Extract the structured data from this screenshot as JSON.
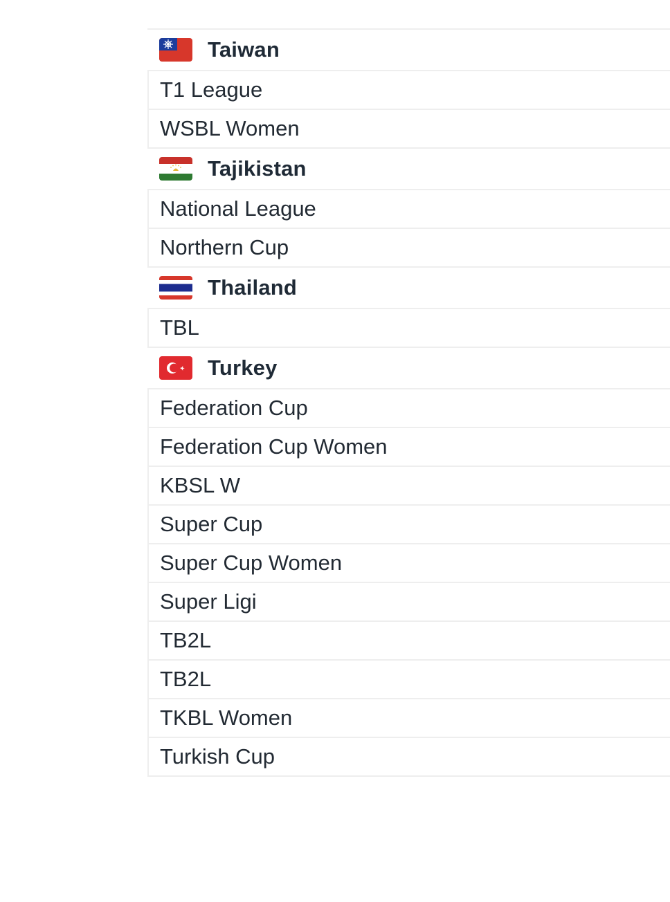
{
  "groups": [
    {
      "country": "Taiwan",
      "flag_icon": "taiwan-flag-icon",
      "leagues": [
        "T1 League",
        "WSBL Women"
      ]
    },
    {
      "country": "Tajikistan",
      "flag_icon": "tajikistan-flag-icon",
      "leagues": [
        "National League",
        "Northern Cup"
      ]
    },
    {
      "country": "Thailand",
      "flag_icon": "thailand-flag-icon",
      "leagues": [
        "TBL"
      ]
    },
    {
      "country": "Turkey",
      "flag_icon": "turkey-flag-icon",
      "leagues": [
        "Federation Cup",
        "Federation Cup Women",
        "KBSL W",
        "Super Cup",
        "Super Cup Women",
        "Super Ligi",
        "TB2L",
        "TB2L",
        "TKBL Women",
        "Turkish Cup"
      ]
    }
  ],
  "colors": {
    "divider": "#eeeeee",
    "country_text": "#1f2a36",
    "league_text": "#222a33"
  }
}
